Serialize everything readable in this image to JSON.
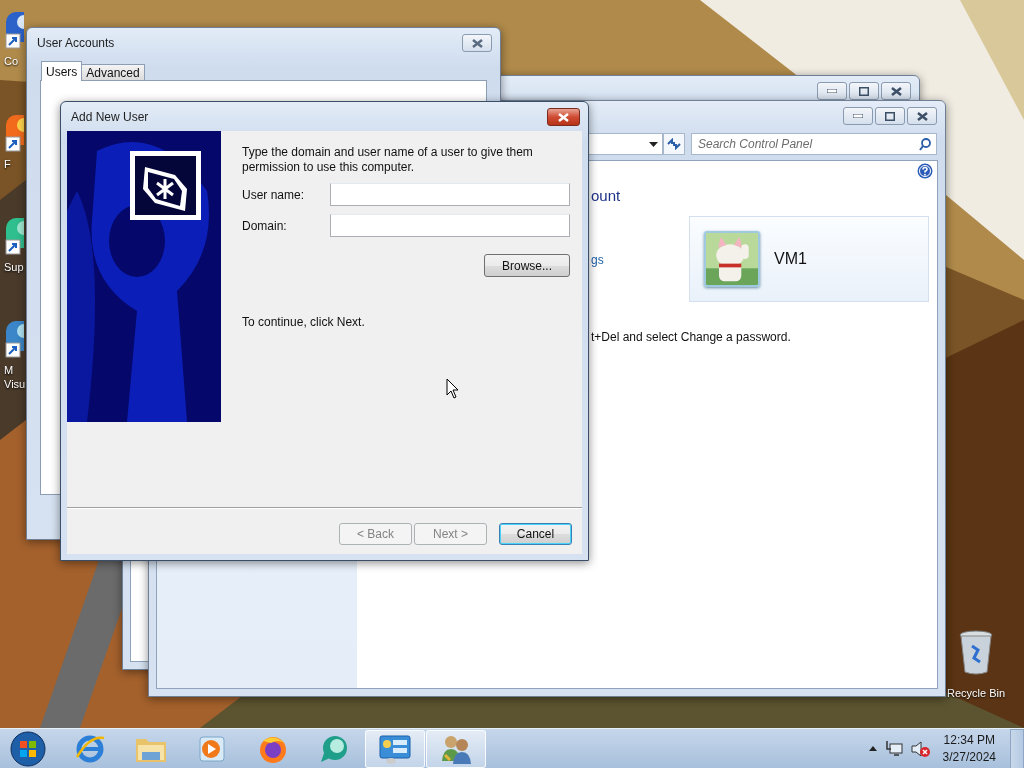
{
  "desktop": {
    "icons": [
      {
        "kind": "computer",
        "lines": [
          "Co"
        ]
      },
      {
        "kind": "firefox",
        "lines": [
          "F"
        ]
      },
      {
        "kind": "app",
        "lines": [
          "Sup"
        ]
      },
      {
        "kind": "studio",
        "lines": [
          "M",
          "Visu"
        ]
      }
    ],
    "recycle_bin": {
      "label": "Recycle Bin"
    }
  },
  "control_panel": {
    "search": {
      "placeholder": "Search Control Panel"
    },
    "heading": "ount",
    "link": "gs",
    "account": {
      "name": "VM1"
    },
    "note": "t+Del and select Change a password."
  },
  "user_accounts": {
    "title": "User Accounts",
    "tabs": [
      {
        "label": "Users",
        "selected": true
      },
      {
        "label": "Advanced",
        "selected": false
      }
    ]
  },
  "add_user_dialog": {
    "title": "Add New User",
    "intro": "Type the domain and user name of a user to give them permission to use this computer.",
    "fields": [
      {
        "label": "User name:"
      },
      {
        "label": "Domain:"
      }
    ],
    "browse": "Browse...",
    "hint": "To continue, click Next.",
    "buttons": [
      {
        "label": "< Back",
        "disabled": true,
        "default": false
      },
      {
        "label": "Next >",
        "disabled": true,
        "default": false
      },
      {
        "label": "Cancel",
        "disabled": false,
        "default": true
      }
    ]
  },
  "taskbar": {
    "apps": [
      {
        "kind": "browser",
        "active": false
      },
      {
        "kind": "folder",
        "active": false
      },
      {
        "kind": "media",
        "active": false
      },
      {
        "kind": "firefox",
        "active": false
      },
      {
        "kind": "chat",
        "active": false
      },
      {
        "kind": "control-panel",
        "active": true
      },
      {
        "kind": "users",
        "active": true
      }
    ],
    "clock": {
      "time": "12:34 PM",
      "date": "3/27/2024"
    }
  }
}
